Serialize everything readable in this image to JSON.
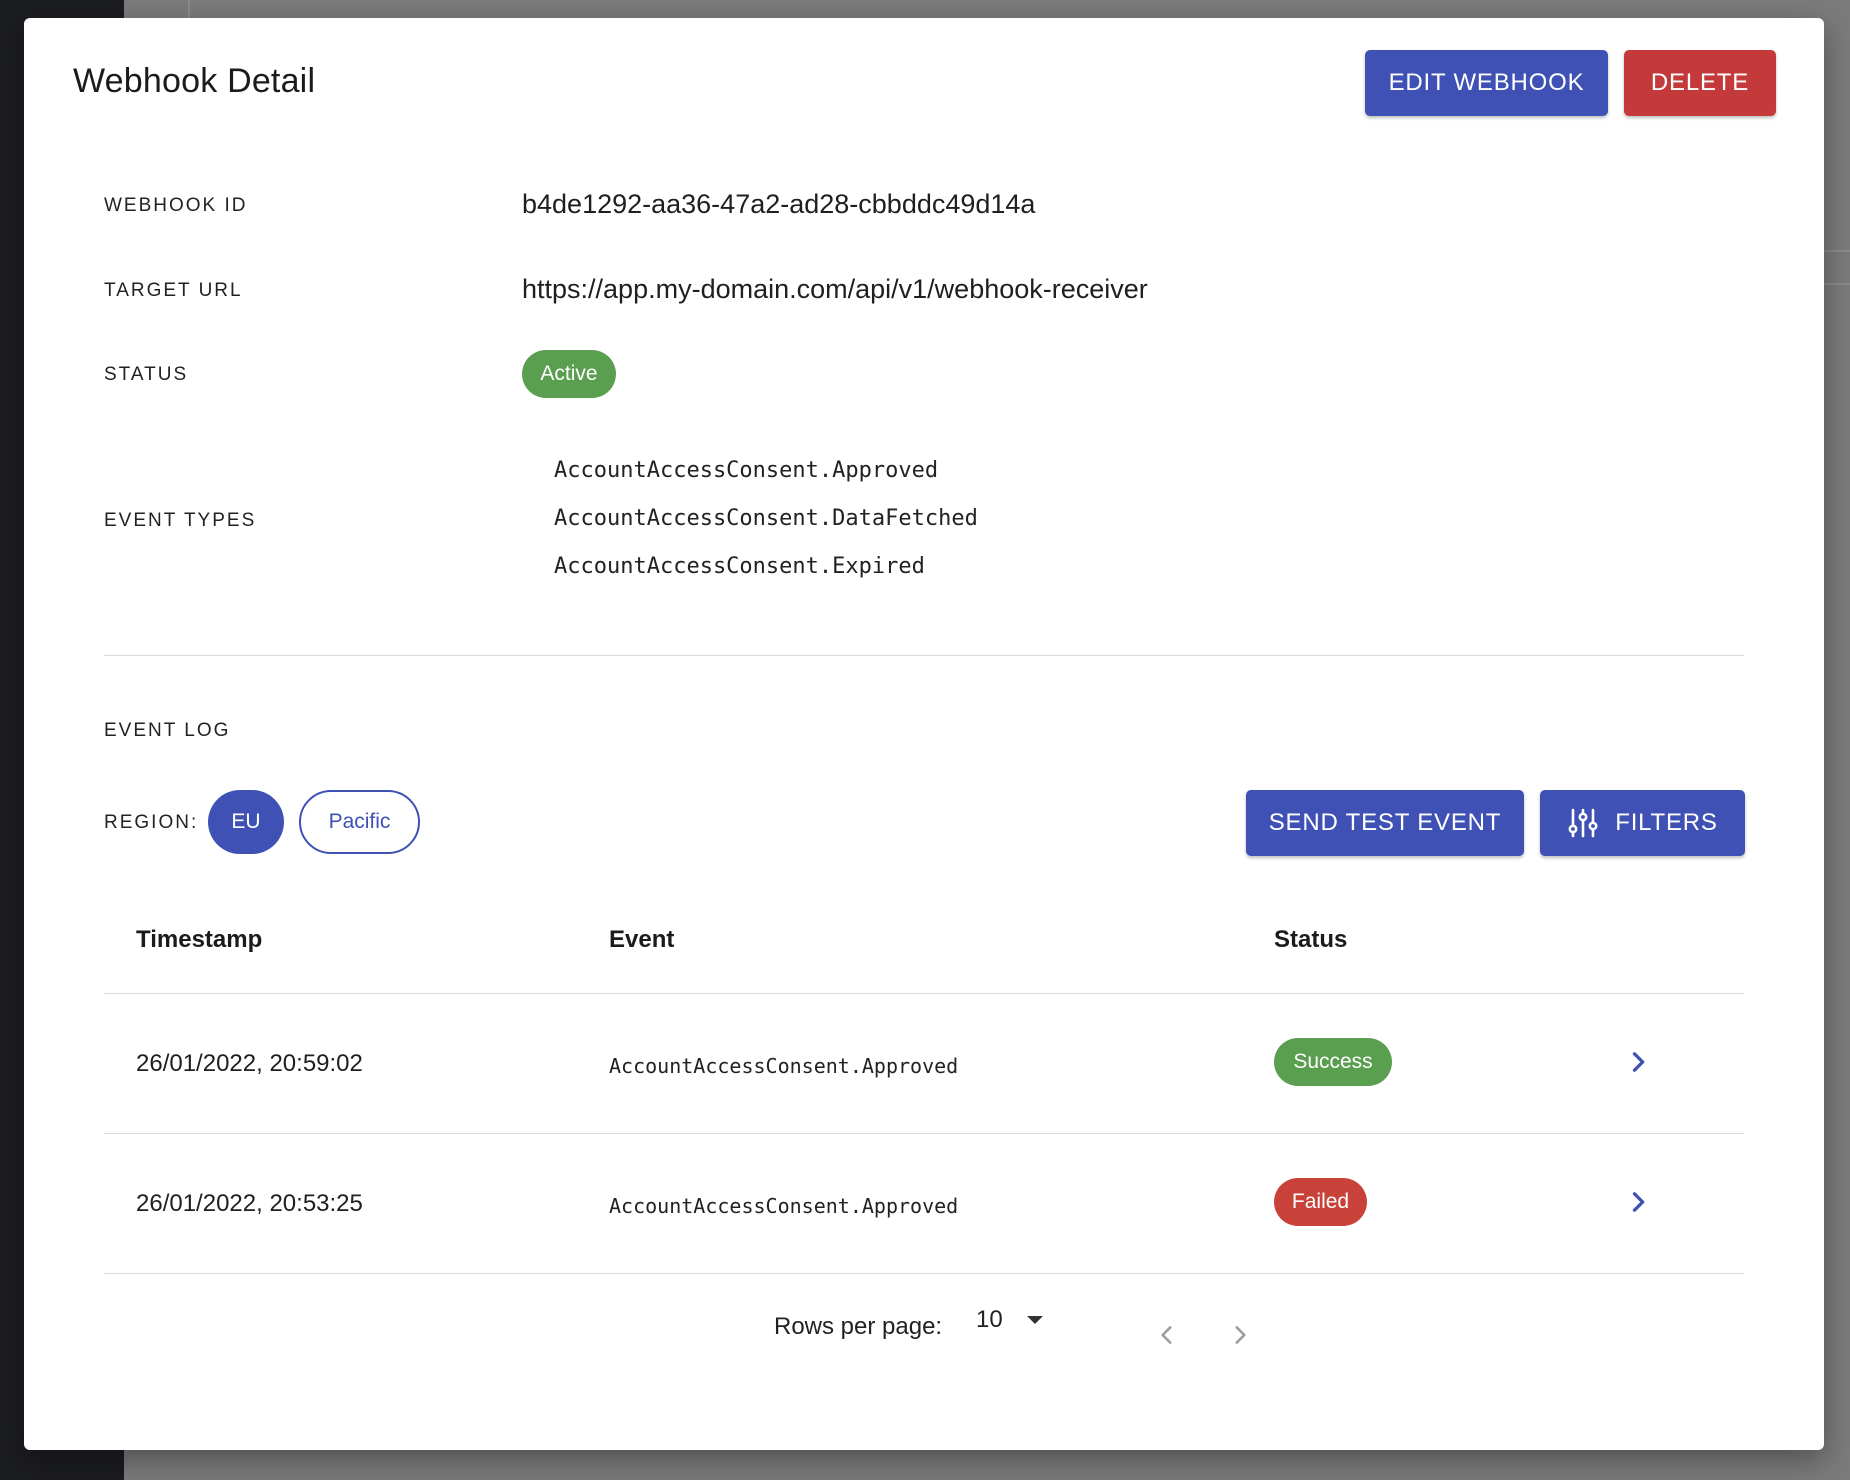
{
  "dialog": {
    "title": "Webhook Detail",
    "edit_label": "EDIT WEBHOOK",
    "delete_label": "DELETE"
  },
  "details": {
    "webhook_id_label": "WEBHOOK ID",
    "webhook_id": "b4de1292-aa36-47a2-ad28-cbbddc49d14a",
    "target_url_label": "TARGET URL",
    "target_url": "https://app.my-domain.com/api/v1/webhook-receiver",
    "status_label": "STATUS",
    "status": "Active",
    "event_types_label": "EVENT TYPES",
    "event_types": [
      "AccountAccessConsent.Approved",
      "AccountAccessConsent.DataFetched",
      "AccountAccessConsent.Expired"
    ]
  },
  "event_log": {
    "heading": "EVENT LOG",
    "region_label": "REGION:",
    "regions": [
      "EU",
      "Pacific"
    ],
    "selected_region": "EU",
    "send_test_label": "SEND TEST EVENT",
    "filters_label": "FILTERS",
    "columns": [
      "Timestamp",
      "Event",
      "Status"
    ],
    "rows": [
      {
        "timestamp": "26/01/2022, 20:59:02",
        "event": "AccountAccessConsent.Approved",
        "status": "Success"
      },
      {
        "timestamp": "26/01/2022, 20:53:25",
        "event": "AccountAccessConsent.Approved",
        "status": "Failed"
      }
    ],
    "pagination": {
      "rows_per_page_label": "Rows per page:",
      "rows_per_page": "10"
    }
  },
  "colors": {
    "primary": "#3f51b5",
    "danger": "#c4393a",
    "success": "#5a9e4f",
    "failed": "#c9423a"
  },
  "icons": [
    "tune-icon",
    "chevron-right-icon",
    "arrow-drop-down-icon",
    "chevron-left-icon"
  ]
}
